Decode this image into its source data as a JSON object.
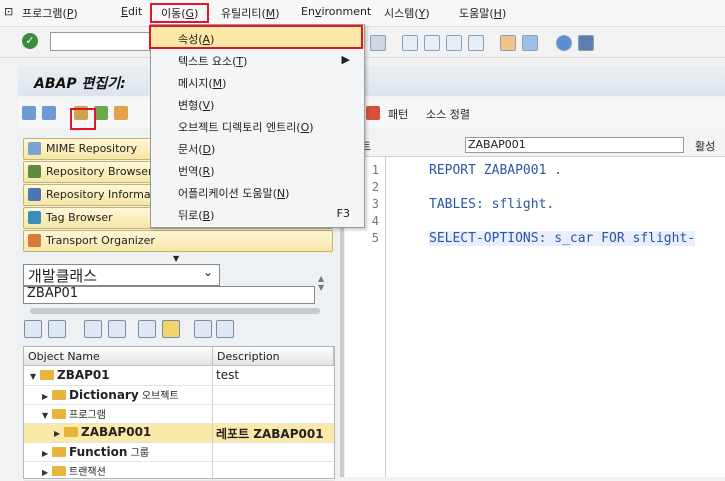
{
  "menubar": {
    "items": [
      {
        "pre": "프로그램(",
        "key": "P",
        "post": ")"
      },
      {
        "pre": "",
        "key": "E",
        "post": "dit"
      },
      {
        "pre": "이동(",
        "key": "G",
        "post": ")"
      },
      {
        "pre": "유틸리티(",
        "key": "M",
        "post": ")"
      },
      {
        "pre": "En",
        "key": "v",
        "post": "ironment"
      },
      {
        "pre": "시스템(",
        "key": "Y",
        "post": ")"
      },
      {
        "pre": "도움말(",
        "key": "H",
        "post": ")"
      }
    ]
  },
  "menu": {
    "items": [
      {
        "pre": "속성(",
        "key": "A",
        "post": ")",
        "shortcut": ""
      },
      {
        "pre": "텍스트 요소(",
        "key": "T",
        "post": ")",
        "shortcut": "▶"
      },
      {
        "pre": "메시지(",
        "key": "M",
        "post": ")",
        "shortcut": ""
      },
      {
        "pre": "변형(",
        "key": "V",
        "post": ")",
        "shortcut": ""
      },
      {
        "pre": "오브젝트 디렉토리 엔트리(",
        "key": "O",
        "post": ")",
        "shortcut": ""
      },
      {
        "pre": "문서(",
        "key": "D",
        "post": ")",
        "shortcut": ""
      },
      {
        "pre": "번역(",
        "key": "R",
        "post": ")",
        "shortcut": ""
      },
      {
        "pre": "어플리케이션 도움말(",
        "key": "N",
        "post": ")",
        "shortcut": ""
      },
      {
        "pre": "뒤로(",
        "key": "B",
        "post": ")",
        "shortcut": "F3"
      }
    ]
  },
  "title": "ABAP 편집기: ",
  "apptb": {
    "pattern": "패턴",
    "pretty": "소스 정렬"
  },
  "nav": [
    "MIME Repository",
    "Repository Browser",
    "Repository Informati",
    "Tag Browser",
    "Transport Organizer"
  ],
  "browser": {
    "dropdown": "개발클래스",
    "object": "ZBAP01"
  },
  "tree": {
    "headers": [
      "Object Name",
      "Description"
    ],
    "rows": [
      {
        "name": "ZBAP01",
        "desc": "test"
      },
      {
        "name": "Dictionary",
        "suffix": " 오브젝트",
        "desc": ""
      },
      {
        "name": "프로그램",
        "desc": ""
      },
      {
        "name": "ZABAP001",
        "desc": "레포트 ZABAP001"
      },
      {
        "name": "Function",
        "suffix": " 그룹",
        "desc": ""
      },
      {
        "name": "트랜잭션",
        "desc": ""
      }
    ]
  },
  "editor": {
    "label": "포트",
    "program": "ZABAP001",
    "status": "활성",
    "lines": [
      {
        "n": "1",
        "code": "REPORT ZABAP001 ."
      },
      {
        "n": "2",
        "code": ""
      },
      {
        "n": "3",
        "code": "TABLES: sflight."
      },
      {
        "n": "4",
        "code": ""
      },
      {
        "n": "5",
        "code": "SELECT-OPTIONS: s_car FOR sflight-"
      }
    ]
  }
}
